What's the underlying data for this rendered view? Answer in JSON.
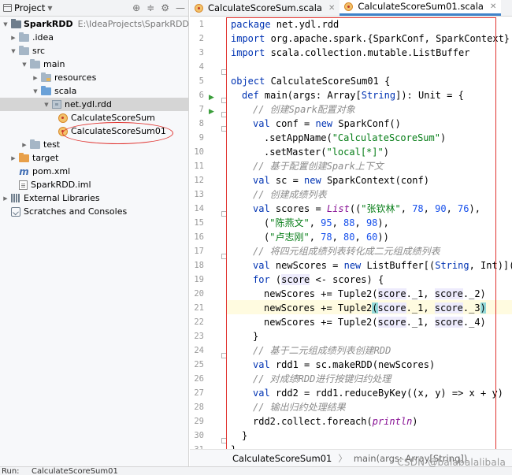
{
  "project_panel": {
    "title": "Project",
    "tree": [
      {
        "label": "SparkRDD",
        "path": "E:\\IdeaProjects\\SparkRDD"
      },
      {
        "label": ".idea"
      },
      {
        "label": "src"
      },
      {
        "label": "main"
      },
      {
        "label": "resources"
      },
      {
        "label": "scala"
      },
      {
        "label": "net.ydl.rdd"
      },
      {
        "label": "CalculateScoreSum"
      },
      {
        "label": "CalculateScoreSum01"
      },
      {
        "label": "test"
      },
      {
        "label": "target"
      },
      {
        "label": "pom.xml"
      },
      {
        "label": "SparkRDD.iml"
      },
      {
        "label": "External Libraries"
      },
      {
        "label": "Scratches and Consoles"
      }
    ]
  },
  "tabs": [
    {
      "label": "CalculateScoreSum.scala"
    },
    {
      "label": "CalculateScoreSum01.scala"
    }
  ],
  "line_numbers": [
    "1",
    "2",
    "3",
    "4",
    "5",
    "6",
    "7",
    "8",
    "9",
    "10",
    "11",
    "12",
    "13",
    "14",
    "15",
    "16",
    "17",
    "18",
    "19",
    "20",
    "21",
    "22",
    "23",
    "24",
    "25",
    "26",
    "27",
    "28",
    "29",
    "30",
    "31"
  ],
  "code": {
    "l1": [
      "package ",
      "net.ydl.rdd"
    ],
    "l2": [
      "import ",
      "org.apache.spark.{SparkConf, SparkContext}"
    ],
    "l3": [
      "import ",
      "scala.collection.mutable.ListBuffer"
    ],
    "l5": [
      "object ",
      "CalculateScoreSum01 {"
    ],
    "l6": [
      "def ",
      "main(args: Array[",
      "String",
      "]): Unit = {"
    ],
    "l7": "// 创建Spark配置对象",
    "l8": [
      "val ",
      "conf = ",
      "new ",
      "SparkConf()"
    ],
    "l9": [
      ".setAppName(",
      "\"CalculateScoreSum\"",
      ")"
    ],
    "l10": [
      ".setMaster(",
      "\"local[*]\"",
      ")"
    ],
    "l11": "// 基于配置创建Spark上下文",
    "l12": [
      "val ",
      "sc = ",
      "new ",
      "SparkContext(conf)"
    ],
    "l13": "// 创建成绩列表",
    "l14": [
      "val ",
      "scores = ",
      "List",
      "((",
      "\"张钦林\"",
      ", ",
      "78",
      ", ",
      "90",
      ", ",
      "76",
      "),"
    ],
    "l15": [
      "(",
      "\"陈燕文\"",
      ", ",
      "95",
      ", ",
      "88",
      ", ",
      "98",
      "),"
    ],
    "l16": [
      "(",
      "\"卢志刚\"",
      ", ",
      "78",
      ", ",
      "80",
      ", ",
      "60",
      "))"
    ],
    "l17": "// 将四元组成绩列表转化成二元组成绩列表",
    "l18": [
      "val ",
      "newScores = ",
      "new ",
      "ListBuffer[(",
      "String",
      ", Int)]()"
    ],
    "l19": [
      "for ",
      "(",
      "score",
      " <- scores) {"
    ],
    "l20": [
      "newScores += Tuple2(",
      "score",
      "._1, ",
      "score",
      "._2)"
    ],
    "l21": [
      "newScores += Tuple2",
      "(",
      "score",
      "._1, ",
      "score",
      "._3",
      ")"
    ],
    "l22": [
      "newScores += Tuple2(",
      "score",
      "._1, ",
      "score",
      "._4)"
    ],
    "l23": "}",
    "l24": "// 基于二元组成绩列表创建RDD",
    "l25": [
      "val ",
      "rdd1 = sc.makeRDD(newScores)"
    ],
    "l26": "// 对成绩RDD进行按键归约处理",
    "l27": [
      "val ",
      "rdd2 = rdd1.reduceByKey((x, y) => x + y)"
    ],
    "l28": "// 输出归约处理结果",
    "l29": [
      "rdd2.collect.foreach(",
      "println",
      ")"
    ],
    "l30": "}",
    "l31": "}"
  },
  "breadcrumb": {
    "first": "CalculateScoreSum01",
    "sep": "〉",
    "second": "main(args: Array[String])"
  },
  "bottom": {
    "run_label": "Run:",
    "run_tab": "CalculateScoreSum01"
  },
  "watermark": "CSDN @balabalalibala",
  "colors": {
    "keyword": "#0033b3",
    "string": "#067d17",
    "number": "#1750eb",
    "comment": "#8c8c8c",
    "annotation_red": "#e0332f"
  }
}
